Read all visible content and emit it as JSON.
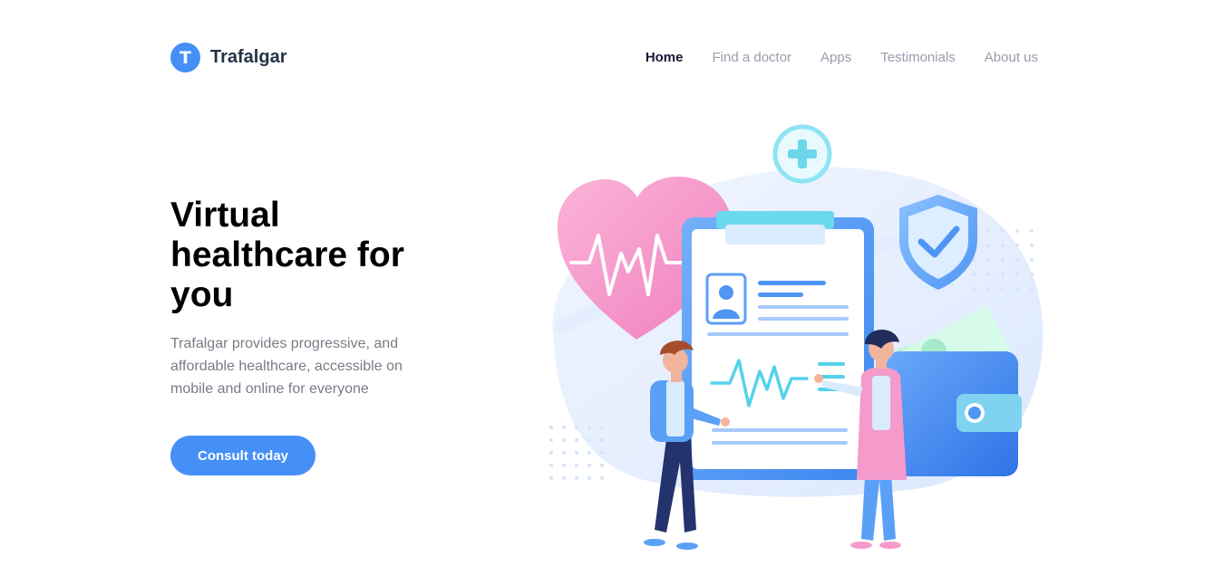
{
  "brand": {
    "initial": "T",
    "name": "Trafalgar",
    "accent": "#458ff6"
  },
  "nav": {
    "items": [
      {
        "label": "Home",
        "active": true
      },
      {
        "label": "Find a doctor",
        "active": false
      },
      {
        "label": "Apps",
        "active": false
      },
      {
        "label": "Testimonials",
        "active": false
      },
      {
        "label": "About us",
        "active": false
      }
    ]
  },
  "hero": {
    "title": "Virtual healthcare for you",
    "description": "Trafalgar provides progressive, and affordable healthcare, accessible on mobile and online for everyone",
    "cta_label": "Consult today"
  },
  "illustration": {
    "icons": [
      "heart-icon",
      "plus-icon",
      "shield-check-icon",
      "wallet-icon",
      "clipboard-icon",
      "doctor-figure",
      "patient-figure"
    ]
  }
}
